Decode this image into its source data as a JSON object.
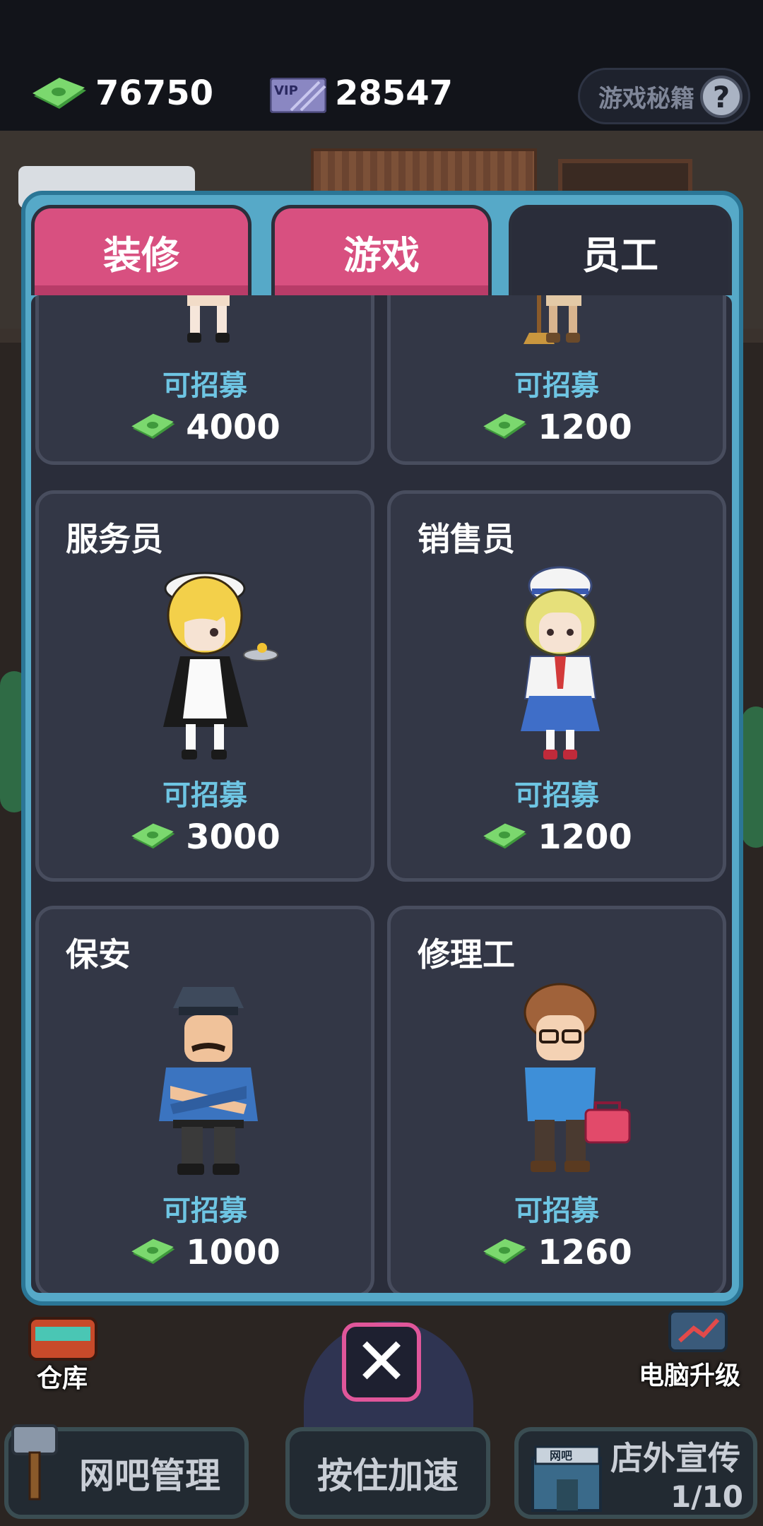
{
  "header": {
    "cash": "76750",
    "vip_points": "28547",
    "vip_icon_text": "VIP",
    "tips_label": "游戏秘籍",
    "tips_icon": "?"
  },
  "tabs": [
    {
      "label": "装修",
      "active": false
    },
    {
      "label": "游戏",
      "active": false
    },
    {
      "label": "员工",
      "active": true
    }
  ],
  "cards": [
    {
      "name": "",
      "status": "可招募",
      "price": "4000",
      "character": "waitress-partial"
    },
    {
      "name": "",
      "status": "可招募",
      "price": "1200",
      "character": "cleaner-partial"
    },
    {
      "name": "服务员",
      "status": "可招募",
      "price": "3000",
      "character": "maid"
    },
    {
      "name": "销售员",
      "status": "可招募",
      "price": "1200",
      "character": "sailor-girl"
    },
    {
      "name": "保安",
      "status": "可招募",
      "price": "1000",
      "character": "police"
    },
    {
      "name": "修理工",
      "status": "可招募",
      "price": "1260",
      "character": "geek"
    }
  ],
  "bottom": {
    "close_icon": "✕",
    "warehouse_label": "仓库",
    "pc_upgrade_label": "电脑升级",
    "manage_label": "网吧管理",
    "speed_label": "按住加速",
    "promo_label": "店外宣传",
    "promo_sign": "网吧",
    "promo_count": "1/10"
  },
  "colors": {
    "panel_border": "#56a9c8",
    "tab_inactive": "#d85080",
    "status_text": "#6ec5e3",
    "cash_green": "#58c456"
  }
}
